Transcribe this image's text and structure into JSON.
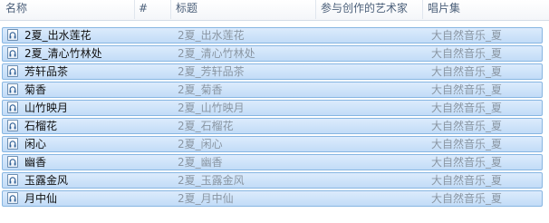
{
  "columns": {
    "name": "名称",
    "number": "#",
    "title": "标题",
    "artist": "参与创作的艺术家",
    "album": "唱片集"
  },
  "rows": [
    {
      "name": "2夏_出水莲花",
      "title": "2夏_出水莲花",
      "album": "大自然音乐_夏",
      "icon": "audio-file-icon"
    },
    {
      "name": "2夏_清心竹林处",
      "title": "2夏_清心竹林处",
      "album": "大自然音乐_夏",
      "icon": "audio-file-icon"
    },
    {
      "name": "芳轩品茶",
      "title": "2夏_芳轩品茶",
      "album": "大自然音乐_夏",
      "icon": "audio-file-icon"
    },
    {
      "name": "菊香",
      "title": "2夏_菊香",
      "album": "大自然音乐_夏",
      "icon": "audio-file-icon"
    },
    {
      "name": "山竹映月",
      "title": "2夏_山竹映月",
      "album": "大自然音乐_夏",
      "icon": "audio-file-icon"
    },
    {
      "name": "石榴花",
      "title": "2夏_石榴花",
      "album": "大自然音乐_夏",
      "icon": "audio-file-icon"
    },
    {
      "name": "闲心",
      "title": "2夏_闲心",
      "album": "大自然音乐_夏",
      "icon": "audio-file-icon"
    },
    {
      "name": "幽香",
      "title": "2夏_幽香",
      "album": "大自然音乐_夏",
      "icon": "audio-file-icon"
    },
    {
      "name": "玉露金风",
      "title": "2夏_玉露金风",
      "album": "大自然音乐_夏",
      "icon": "audio-file-icon"
    },
    {
      "name": "月中仙",
      "title": "2夏_月中仙",
      "album": "大自然音乐_夏",
      "icon": "audio-file-icon"
    }
  ]
}
